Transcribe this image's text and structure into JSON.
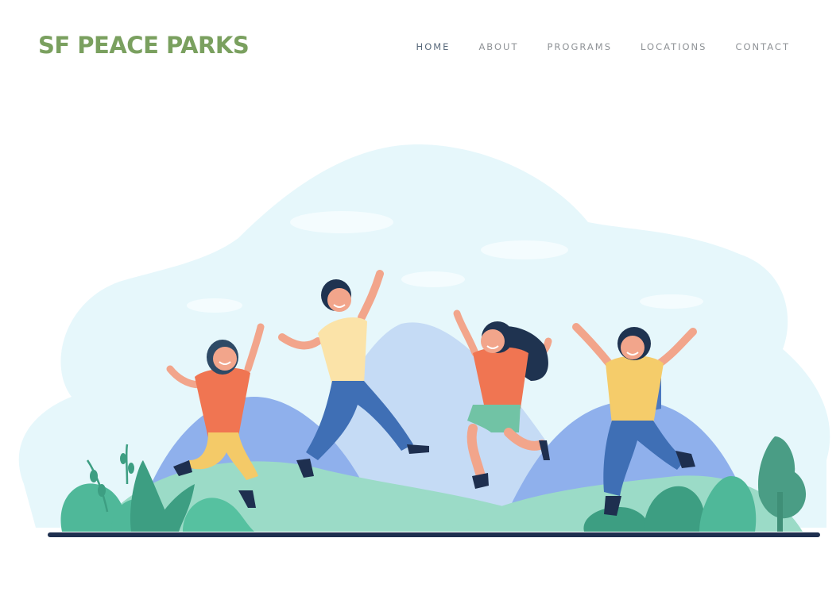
{
  "header": {
    "logo_text": "SF PEACE PARKS",
    "nav": [
      {
        "label": "HOME",
        "active": true
      },
      {
        "label": "ABOUT",
        "active": false
      },
      {
        "label": "PROGRAMS",
        "active": false
      },
      {
        "label": "LOCATIONS",
        "active": false
      },
      {
        "label": "CONTACT",
        "active": false
      }
    ]
  },
  "colors": {
    "logo": "#7aa05f",
    "nav_text": "#8f9397",
    "nav_active": "#5a6a7c",
    "sky_blob": "#e6f7fb",
    "mountains": "#8fb0ec",
    "hills": "#9bdbc7",
    "ground_line": "#1e2f4f"
  },
  "hero": {
    "illustration": "children-jumping-in-park-illustration"
  }
}
